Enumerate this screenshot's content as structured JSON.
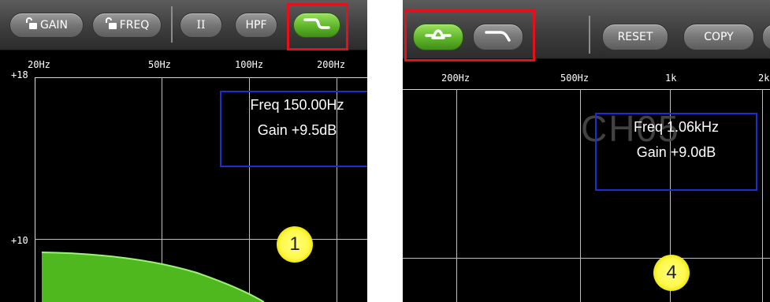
{
  "left_panel": {
    "toolbar": {
      "gain_label": "GAIN",
      "freq_label": "FREQ",
      "q_label": "II",
      "hpf_label": "HPF",
      "shelf_button_state": "active-green"
    },
    "freq_axis": [
      "20Hz",
      "50Hz",
      "100Hz",
      "200Hz"
    ],
    "gain_axis": {
      "top": "+18",
      "mid": "+10"
    },
    "readout": {
      "freq": "Freq  150.00Hz",
      "gain": "Gain +9.5dB"
    },
    "marker": "1"
  },
  "right_panel": {
    "toolbar": {
      "reset_label": "RESET",
      "copy_label": "COPY",
      "eq_shape_selected": "peaking"
    },
    "freq_axis": [
      "200Hz",
      "500Hz",
      "1k",
      "2k"
    ],
    "readout": {
      "freq": "Freq  1.06kHz",
      "gain": "Gain +9.0dB"
    },
    "watermark": "CH05",
    "marker": "4"
  },
  "colors": {
    "highlight_red": "#e4101b",
    "readout_blue": "#1c2ed0",
    "eq_curve_green": "#4fb81f",
    "button_green": "#5fb52a",
    "marker_yellow": "#fff84a"
  }
}
